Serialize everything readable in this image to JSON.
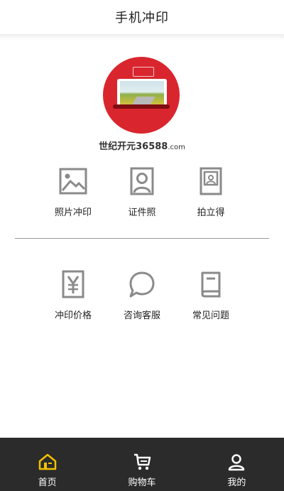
{
  "header": {
    "title": "手机冲印"
  },
  "brand": {
    "name": "世纪开元",
    "phone": "36588",
    "domain": ".com"
  },
  "services_row1": [
    {
      "label": "照片冲印",
      "icon": "picture-icon"
    },
    {
      "label": "证件照",
      "icon": "portrait-icon"
    },
    {
      "label": "拍立得",
      "icon": "instant-photo-icon"
    }
  ],
  "services_row2": [
    {
      "label": "冲印价格",
      "icon": "yen-price-icon"
    },
    {
      "label": "咨询客服",
      "icon": "chat-bubble-icon"
    },
    {
      "label": "常见问题",
      "icon": "book-icon"
    }
  ],
  "bottom_nav": {
    "items": [
      {
        "label": "首页",
        "icon": "home-icon",
        "active": true
      },
      {
        "label": "购物车",
        "icon": "cart-icon",
        "active": false
      },
      {
        "label": "我的",
        "icon": "user-icon",
        "active": false
      }
    ],
    "active_color": "#f2c200",
    "color": "#ffffff"
  },
  "colors": {
    "brand_red": "#d9262e",
    "icon_gray": "#8a8a8a",
    "nav_bg": "#2b2b2b"
  }
}
